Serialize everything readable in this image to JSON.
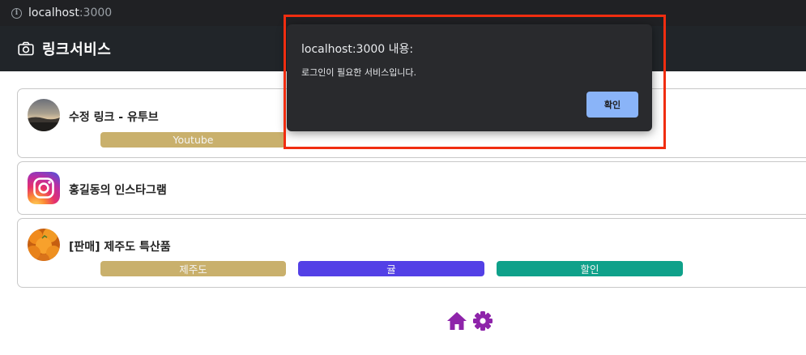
{
  "browser": {
    "url_host": "localhost",
    "url_port": ":3000"
  },
  "header": {
    "brand": "링크서비스"
  },
  "links": [
    {
      "title": "수정 링크 - 유투브",
      "tags": [
        {
          "label": "Youtube",
          "color": "#c9b06c"
        }
      ]
    },
    {
      "title": "홍길동의 인스타그램",
      "tags": []
    },
    {
      "title": "[판매] 제주도 특산품",
      "tags": [
        {
          "label": "제주도",
          "color": "#c9b06c"
        },
        {
          "label": "귤",
          "color": "#5340e6"
        },
        {
          "label": "할인",
          "color": "#0fa18a"
        }
      ]
    }
  ],
  "nav": {
    "icons": [
      "home-icon",
      "gear-icon"
    ],
    "color": "#8e24aa"
  },
  "dialog": {
    "title": "localhost:3000 내용:",
    "message": "로그인이 필요한 서비스입니다.",
    "ok_label": "확인"
  }
}
